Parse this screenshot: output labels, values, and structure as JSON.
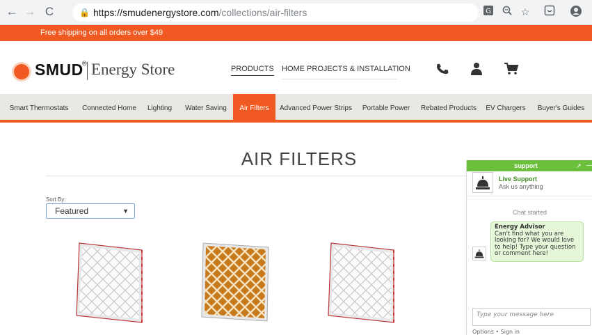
{
  "browser": {
    "url_host": "https://smudenergystore.com",
    "url_path": "/collections/air-filters"
  },
  "promo": {
    "text": "Free shipping on all orders over $49"
  },
  "header": {
    "logo_brand": "SMUD",
    "logo_reg": "®",
    "logo_store": "Energy Store",
    "links": [
      "PRODUCTS",
      "HOME PROJECTS & INSTALLATION"
    ],
    "icons": [
      "phone-icon",
      "account-icon",
      "cart-icon"
    ]
  },
  "categories": [
    "Smart Thermostats",
    "Connected Home",
    "Lighting",
    "Water Saving",
    "Air Filters",
    "Advanced Power Strips",
    "Portable Power",
    "Rebated Products",
    "EV Chargers",
    "Buyer's Guides"
  ],
  "active_category": "Air Filters",
  "main": {
    "title": "AIR FILTERS",
    "sort_label": "Sort By:",
    "sort_value": "Featured"
  },
  "products": [
    {
      "color": "white"
    },
    {
      "color": "orange"
    },
    {
      "color": "white"
    }
  ],
  "chat": {
    "header": "support",
    "live_title": "Live Support",
    "live_sub": "Ask us anything",
    "started": "Chat started",
    "agent": "Energy Advisor",
    "message": "Can't find what you are looking for? We would love to help! Type your question or comment here!",
    "input_placeholder": "Type your message here",
    "footer": "Options • Sign in"
  },
  "colors": {
    "brand_orange": "#f05a22",
    "chat_green": "#6cbf3d"
  }
}
